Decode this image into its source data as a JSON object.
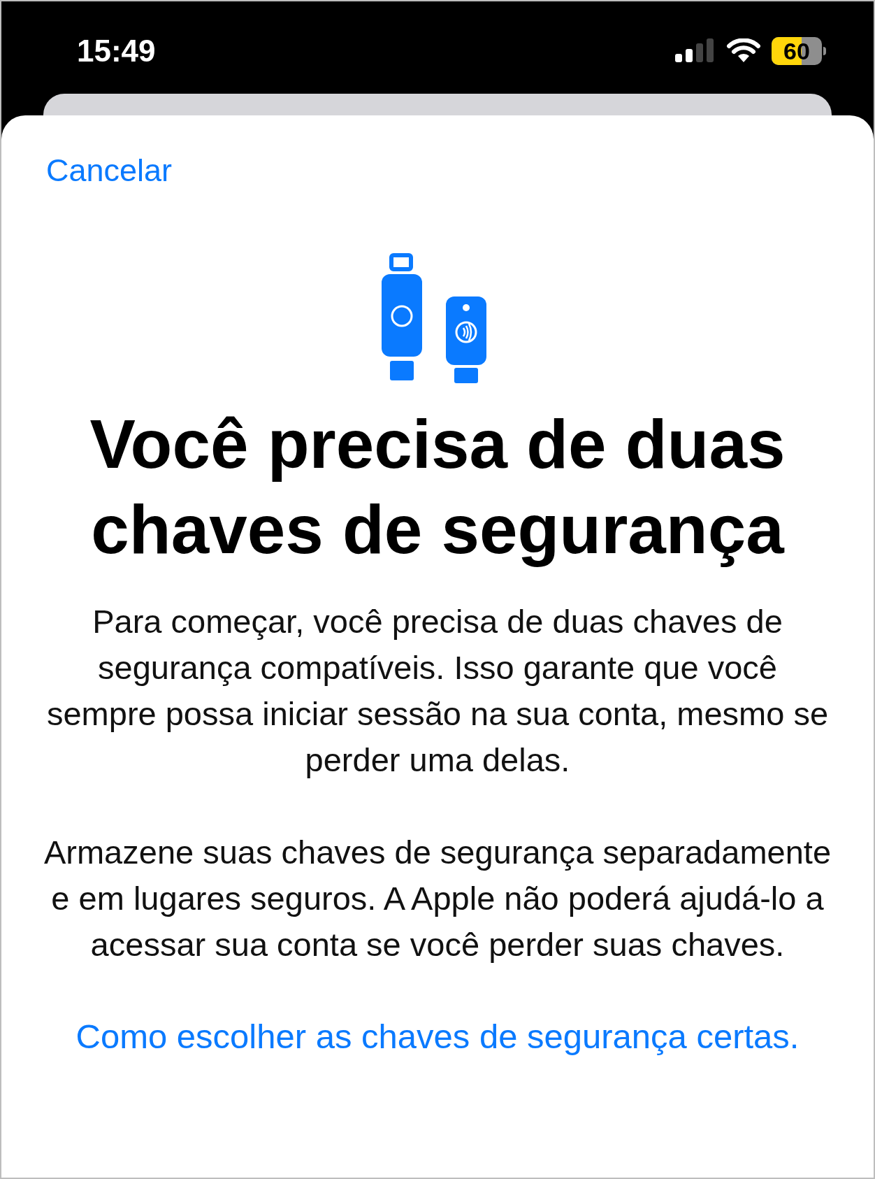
{
  "status_bar": {
    "time": "15:49",
    "battery": "60"
  },
  "sheet": {
    "cancel": "Cancelar",
    "title": "Você precisa de duas chaves de segurança",
    "paragraphs": [
      "Para começar, você precisa de duas chaves de segurança compatíveis. Isso garante que você sempre possa iniciar sessão na sua conta, mesmo se perder uma delas.",
      "Armazene suas chaves de segurança separadamente e em lugares seguros. A Apple não poderá ajudá-lo a acessar sua conta se você perder suas chaves."
    ],
    "link": "Como escolher as chaves de segurança certas."
  }
}
